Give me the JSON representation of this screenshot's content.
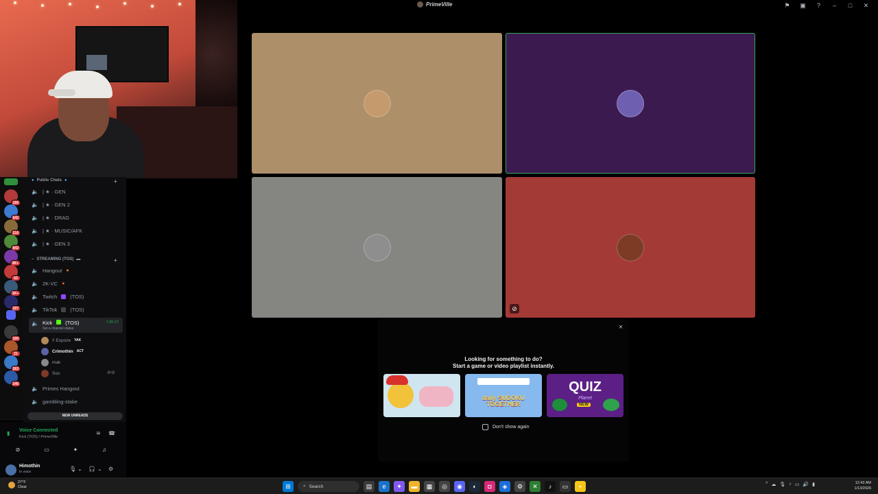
{
  "app": {
    "title": "PrimeVille"
  },
  "stage": {
    "tiles": [
      {
        "color": "#ad8f6a",
        "avatar_color": "#c59a6c"
      },
      {
        "color": "#3a1a4f",
        "avatar_color": "#6f5fb1"
      },
      {
        "color": "#858581",
        "avatar_color": "#8e8e8e"
      },
      {
        "color": "#a43a36",
        "avatar_color": "#7d3a25"
      }
    ]
  },
  "popup": {
    "heading": "Looking for something to do?",
    "subheading": "Start a game or video playlist instantly.",
    "activities": [
      {
        "name": "Chick activity",
        "color": "#cfe5f0"
      },
      {
        "name": "daily SUDOKU TOGETHER",
        "label": "daily SUDOKU TOGETHER",
        "color": "#86b9ee"
      },
      {
        "name": "QUIZ Planet NEW",
        "label": "QUIZ",
        "sub": "Planet",
        "badge": "NEW",
        "color": "#5b1f86"
      }
    ],
    "dont_show": "Don't show again",
    "close_icon": "×"
  },
  "sidebar": {
    "cat_public": "Public Chats",
    "public_channels": [
      "| ★ · GEN",
      "| ★ · GEN 2",
      "| ★ · DRAG",
      "| ★ · MUSIC/AFK",
      "| ★ · GEN 3"
    ],
    "cat_streaming": "STREAMING (TOS)",
    "streaming_channels": [
      "Hangout",
      "2K-VC",
      "Twitch",
      "TikTok"
    ],
    "twitch_suffix": "(TOS)",
    "tiktok_suffix": "(TOS)",
    "active_channel": {
      "name": "Kick",
      "suffix": "(TOS)",
      "status": "Set a channel status",
      "time": "7:36:27"
    },
    "voice_users": [
      {
        "name": "!! Expoze",
        "tag": "YAK"
      },
      {
        "name": "Crimothin",
        "tag": "ACT"
      },
      {
        "name": "mak",
        "tag": ""
      },
      {
        "name": "Sos",
        "tag": ""
      }
    ],
    "more_channels": [
      "Primes Hangout",
      "gambling-stake"
    ],
    "new_unreads": "NEW UNREADS"
  },
  "servers": {
    "badges": [
      "166",
      "642",
      "216",
      "842",
      "3K+",
      "63",
      "1K+",
      "397",
      "100",
      "21",
      "263",
      "246"
    ]
  },
  "voice": {
    "title": "Voice Connected",
    "subtitle": "Kick (TOS) / PrimeVille",
    "username": "Himothin",
    "status": "In voice"
  },
  "taskbar": {
    "temp": "27°F",
    "weather": "Clear",
    "search": "Search",
    "time": "12:42 AM",
    "date": "1/13/2026"
  }
}
